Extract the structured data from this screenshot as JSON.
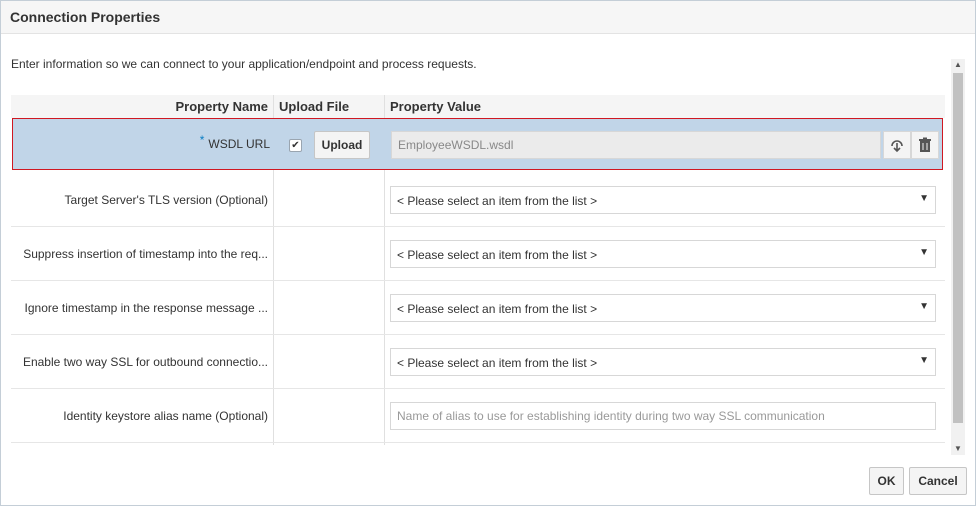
{
  "dialog": {
    "title": "Connection Properties",
    "instructions": "Enter information so we can connect to your application/endpoint and process requests."
  },
  "table": {
    "headers": {
      "property_name": "Property Name",
      "upload_file": "Upload File",
      "property_value": "Property Value"
    },
    "wsdl_row": {
      "required_marker": "*",
      "name": "WSDL URL",
      "checkbox_checked": true,
      "checkmark": "✔",
      "upload_label": "Upload",
      "value": "EmployeeWSDL.wsdl"
    },
    "rows": [
      {
        "name": "Target Server's TLS version (Optional)",
        "type": "select",
        "value": "< Please select an item from the list >"
      },
      {
        "name": "Suppress insertion of timestamp into the req...",
        "type": "select",
        "value": "< Please select an item from the list >"
      },
      {
        "name": "Ignore timestamp in the response message ...",
        "type": "select",
        "value": "< Please select an item from the list >"
      },
      {
        "name": "Enable two way SSL for outbound connectio...",
        "type": "select",
        "value": "< Please select an item from the list >"
      },
      {
        "name": "Identity keystore alias name (Optional)",
        "type": "text",
        "placeholder": "Name of alias to use for establishing identity during two way SSL communication"
      }
    ],
    "select_arrow": "▼"
  },
  "scrollbar": {
    "up": "▲",
    "down": "▼"
  },
  "footer": {
    "ok_label": "OK",
    "cancel_label": "Cancel"
  },
  "colors": {
    "selected_row": "#c1d5e8",
    "selected_border": "#d01822",
    "required": "#0a7dc3"
  }
}
